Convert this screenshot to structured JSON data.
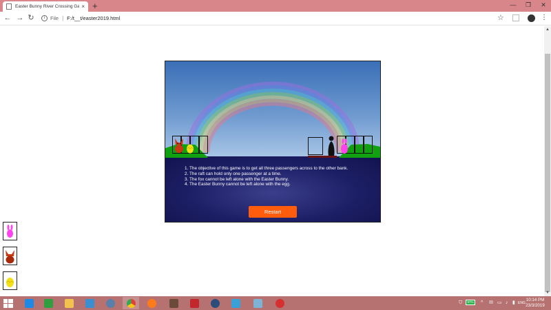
{
  "browser": {
    "tab_title": "Easter Bunny River Crossing Gam",
    "tab_close": "×",
    "new_tab": "+",
    "window_controls": [
      "—",
      "❐",
      "✕"
    ],
    "nav": {
      "back": "←",
      "forward": "→",
      "reload": "↻"
    },
    "address": {
      "scheme_label": "File",
      "separator": "|",
      "url": "F:/t__t/easter2019.html"
    },
    "star": "☆",
    "menu": "⋮"
  },
  "game": {
    "instructions": [
      "1. The objective of this game is to get all three passengers across to the other bank.",
      "2. The raft can hold only one passenger at a time.",
      "3. The fox cannot be left alone with the Easter Bunny.",
      "4. The Easter Bunny cannot be left alone with the egg."
    ],
    "restart_label": "Restart",
    "left_bank": [
      "fox",
      "egg"
    ],
    "right_bank": [
      "bunny"
    ],
    "on_raft": [
      "ferryman"
    ]
  },
  "sidebar_pieces": [
    "bunny",
    "fox",
    "egg"
  ],
  "colors": {
    "fox": "#c83a12",
    "fox_dark": "#8b1e06",
    "egg": "#f2e01a",
    "bunny": "#ff44ee",
    "grass": "#10a010",
    "restart": "#ff5c0d",
    "tabbar": "#d8868a",
    "taskbar": "#b67171"
  },
  "taskbar": {
    "apps": [
      {
        "name": "ie",
        "color": "#1e88e5"
      },
      {
        "name": "store",
        "color": "#2e9e3e"
      },
      {
        "name": "explorer",
        "color": "#f2c14e"
      },
      {
        "name": "pc",
        "color": "#3b8ed0"
      },
      {
        "name": "network",
        "color": "#5b7fa8"
      },
      {
        "name": "chrome",
        "color": "#e34133"
      },
      {
        "name": "firefox",
        "color": "#ff7b1a"
      },
      {
        "name": "video",
        "color": "#6a4b3a"
      },
      {
        "name": "filezilla",
        "color": "#c1272d"
      },
      {
        "name": "steam",
        "color": "#2a4d7a"
      },
      {
        "name": "notepad",
        "color": "#3aa0d8"
      },
      {
        "name": "files",
        "color": "#7fb3d5"
      },
      {
        "name": "app",
        "color": "#d62f2f"
      }
    ],
    "battery": "97%",
    "tray_up": "^",
    "tray_icons": [
      "✉",
      "▭",
      "♪",
      "▮",
      "ENG"
    ],
    "time": "10:14 PM",
    "date": "23/3/2019"
  }
}
